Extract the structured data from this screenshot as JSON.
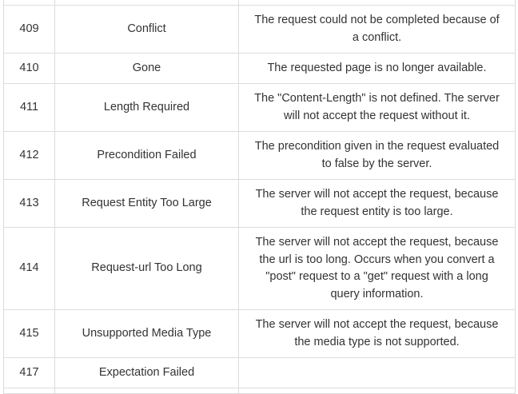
{
  "rows": [
    {
      "code": "409",
      "message": "Conflict",
      "description": [
        "The request could not be completed because of",
        "a conflict."
      ]
    },
    {
      "code": "410",
      "message": "Gone",
      "description": [
        "The requested page is no longer available."
      ]
    },
    {
      "code": "411",
      "message": "Length Required",
      "description": [
        "The \"Content-Length\" is not defined. The server",
        "will not accept the request without it."
      ]
    },
    {
      "code": "412",
      "message": "Precondition Failed",
      "description": [
        "The precondition given in the request evaluated",
        "to false by the server."
      ]
    },
    {
      "code": "413",
      "message": "Request Entity Too Large",
      "description": [
        "The server will not accept the request, because",
        "the request entity is too large."
      ]
    },
    {
      "code": "414",
      "message": "Request-url Too Long",
      "description": [
        "The server will not accept the request, because",
        "the url is too long. Occurs when you convert a",
        "\"post\" request to a \"get\" request with a long",
        "query information."
      ]
    },
    {
      "code": "415",
      "message": "Unsupported Media Type",
      "description": [
        "The server will not accept the request, because",
        "the media type is not supported."
      ]
    },
    {
      "code": "417",
      "message": "Expectation Failed",
      "description": []
    }
  ]
}
